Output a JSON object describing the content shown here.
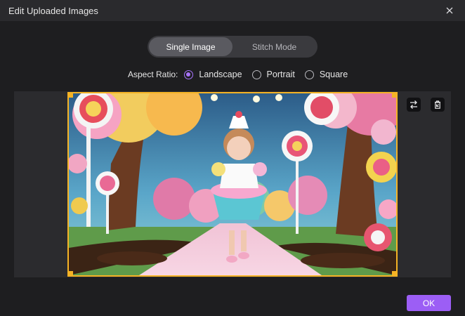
{
  "window": {
    "title": "Edit Uploaded Images"
  },
  "mode_toggle": {
    "options": [
      {
        "label": "Single Image",
        "active": true
      },
      {
        "label": "Stitch Mode",
        "active": false
      }
    ]
  },
  "aspect_ratio": {
    "label": "Aspect Ratio:",
    "options": [
      {
        "label": "Landscape",
        "checked": true
      },
      {
        "label": "Portrait",
        "checked": false
      },
      {
        "label": "Square",
        "checked": false
      }
    ]
  },
  "image_tools": {
    "icons": [
      "swap-icon",
      "trash-icon"
    ]
  },
  "footer": {
    "ok_label": "OK"
  },
  "colors": {
    "accent": "#9c5ef5",
    "radio_checked": "#a974ff",
    "selection_border": "#f5b325",
    "background": "#1e1e20",
    "titlebar": "#2a2a2d"
  }
}
